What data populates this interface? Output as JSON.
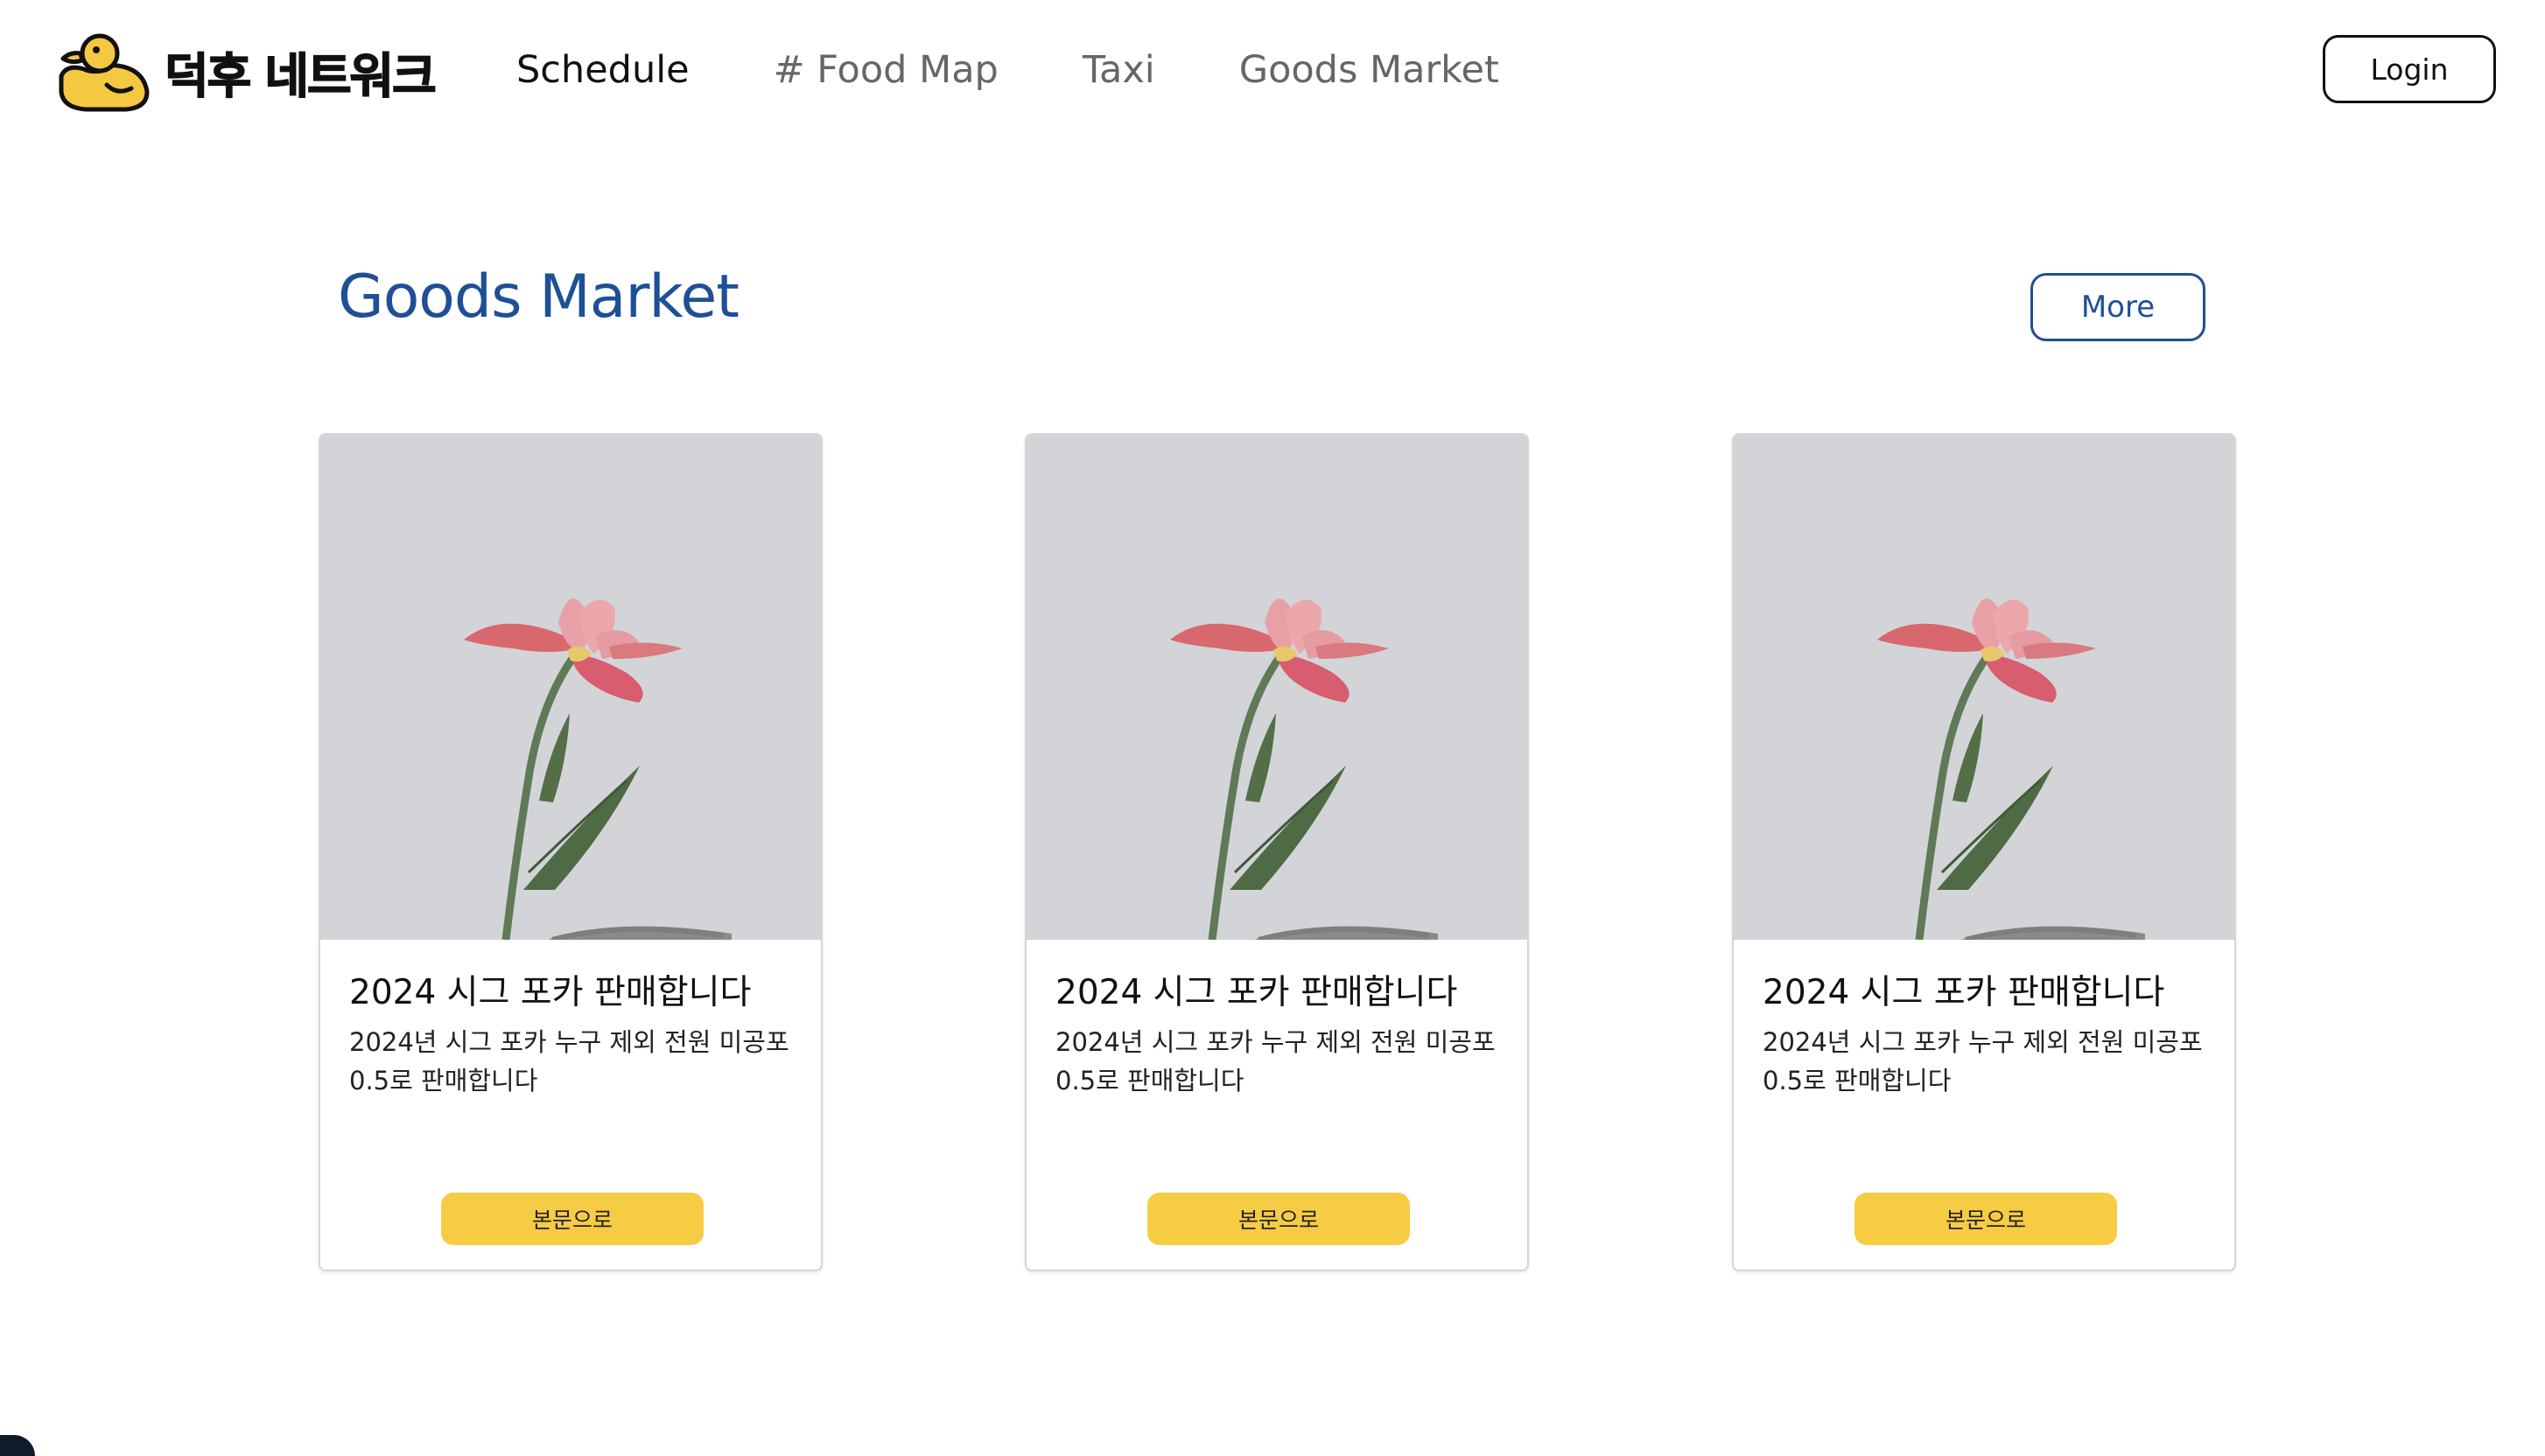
{
  "header": {
    "logo_text": "덕후 네트워크",
    "nav": [
      {
        "label": "Schedule",
        "active": true
      },
      {
        "label": "# Food Map",
        "active": false
      },
      {
        "label": "Taxi",
        "active": false
      },
      {
        "label": "Goods Market",
        "active": false
      }
    ],
    "login_label": "Login"
  },
  "section": {
    "title": "Goods Market",
    "more_label": "More"
  },
  "cards": [
    {
      "title": "2024 시그 포카 판매합니다",
      "description": "2024년 시그 포카 누구 제외 전원 미공포 0.5로 판매합니다",
      "button_label": "본문으로",
      "image": "pink-iris-flower"
    },
    {
      "title": "2024 시그 포카 판매합니다",
      "description": "2024년 시그 포카 누구 제외 전원 미공포 0.5로 판매합니다",
      "button_label": "본문으로",
      "image": "pink-iris-flower"
    },
    {
      "title": "2024 시그 포카 판매합니다",
      "description": "2024년 시그 포카 누구 제외 전원 미공포 0.5로 판매합니다",
      "button_label": "본문으로",
      "image": "pink-iris-flower"
    }
  ],
  "colors": {
    "accent_blue": "#1f4f96",
    "button_yellow": "#f7cc45",
    "duck_yellow": "#f5c842",
    "image_bg": "#d3d4d8"
  }
}
